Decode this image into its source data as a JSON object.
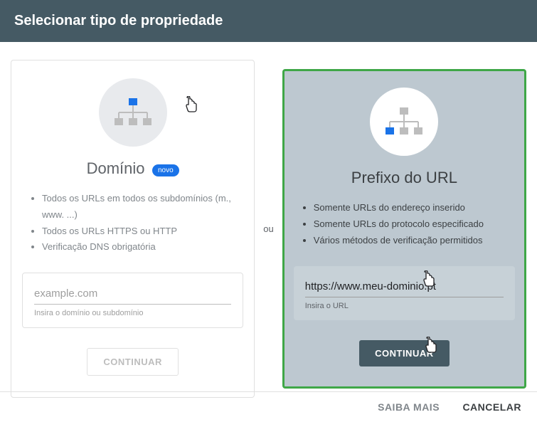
{
  "header": {
    "title": "Selecionar tipo de propriedade"
  },
  "divider": "ou",
  "domain_card": {
    "title": "Domínio",
    "badge": "novo",
    "features": [
      "Todos os URLs em todos os subdomínios (m., www. ...)",
      "Todos os URLs HTTPS ou HTTP",
      "Verificação DNS obrigatória"
    ],
    "input_placeholder": "example.com",
    "input_value": "",
    "input_helper": "Insira o domínio ou subdomínio",
    "continue": "CONTINUAR"
  },
  "url_card": {
    "title": "Prefixo do URL",
    "features": [
      "Somente URLs do endereço inserido",
      "Somente URLs do protocolo especificado",
      "Vários métodos de verificação permitidos"
    ],
    "input_value": "https://www.meu-dominio.pt",
    "input_helper": "Insira o URL",
    "continue": "CONTINUAR"
  },
  "footer": {
    "learn_more": "SAIBA MAIS",
    "cancel": "CANCELAR"
  }
}
